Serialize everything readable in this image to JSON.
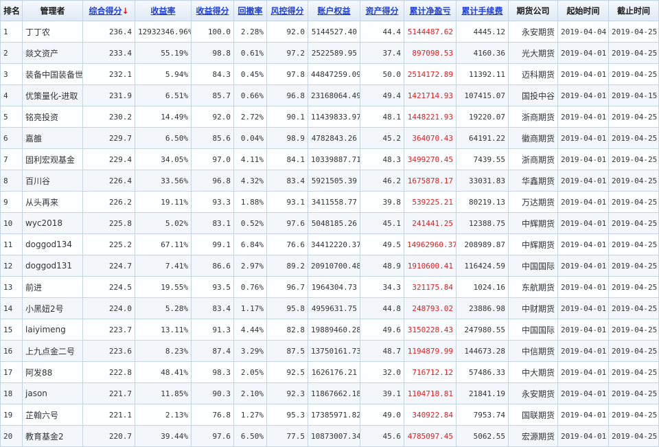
{
  "headers": {
    "rank": "排名",
    "manager": "管理者",
    "total_score": "综合得分",
    "sort_arrow": "↓",
    "return_rate": "收益率",
    "return_score": "收益得分",
    "drawdown": "回撤率",
    "risk_score": "风控得分",
    "equity": "账户权益",
    "asset_score": "资产得分",
    "net_pnl": "累计净盈亏",
    "fees": "累计手续费",
    "company": "期货公司",
    "start": "起始时间",
    "end": "截止时间"
  },
  "colors": {
    "link": "#1f3fd8",
    "negative_highlight": "#e02020",
    "sort_arrow": "#e01010"
  },
  "rows": [
    {
      "rank": "1",
      "manager": "丁丁农",
      "total_score": "236.4",
      "return_rate": "12932346.96%",
      "return_score": "100.0",
      "drawdown": "2.28%",
      "risk_score": "92.0",
      "equity": "5144527.40",
      "asset_score": "44.4",
      "net_pnl": "5144487.62",
      "fees": "4445.12",
      "company": "永安期货",
      "start": "2019-04-04",
      "end": "2019-04-25"
    },
    {
      "rank": "2",
      "manager": "燚文资产",
      "total_score": "233.4",
      "return_rate": "55.19%",
      "return_score": "98.8",
      "drawdown": "0.61%",
      "risk_score": "97.2",
      "equity": "2522589.95",
      "asset_score": "37.4",
      "net_pnl": "897098.53",
      "fees": "4160.36",
      "company": "光大期货",
      "start": "2019-04-01",
      "end": "2019-04-25"
    },
    {
      "rank": "3",
      "manager": "装备中国装备世",
      "total_score": "232.1",
      "return_rate": "5.94%",
      "return_score": "84.3",
      "drawdown": "0.45%",
      "risk_score": "97.8",
      "equity": "44847259.09",
      "asset_score": "50.0",
      "net_pnl": "2514172.89",
      "fees": "11392.11",
      "company": "迈科期货",
      "start": "2019-04-01",
      "end": "2019-04-25"
    },
    {
      "rank": "4",
      "manager": "优策量化-进取",
      "total_score": "231.9",
      "return_rate": "6.51%",
      "return_score": "85.7",
      "drawdown": "0.66%",
      "risk_score": "96.8",
      "equity": "23168064.49",
      "asset_score": "49.4",
      "net_pnl": "1421714.93",
      "fees": "107415.07",
      "company": "国投中谷",
      "start": "2019-04-01",
      "end": "2019-04-15"
    },
    {
      "rank": "5",
      "manager": "铭亮投资",
      "total_score": "230.2",
      "return_rate": "14.49%",
      "return_score": "92.0",
      "drawdown": "2.72%",
      "risk_score": "90.1",
      "equity": "11439833.97",
      "asset_score": "48.1",
      "net_pnl": "1448221.93",
      "fees": "19220.07",
      "company": "浙商期货",
      "start": "2019-04-01",
      "end": "2019-04-25"
    },
    {
      "rank": "6",
      "manager": "嘉雒",
      "total_score": "229.7",
      "return_rate": "6.50%",
      "return_score": "85.6",
      "drawdown": "0.04%",
      "risk_score": "98.9",
      "equity": "4782843.26",
      "asset_score": "45.2",
      "net_pnl": "364070.43",
      "fees": "64191.22",
      "company": "徽商期货",
      "start": "2019-04-01",
      "end": "2019-04-25"
    },
    {
      "rank": "7",
      "manager": "固利宏观基金",
      "total_score": "229.4",
      "return_rate": "34.05%",
      "return_score": "97.0",
      "drawdown": "4.11%",
      "risk_score": "84.1",
      "equity": "10339887.71",
      "asset_score": "48.3",
      "net_pnl": "3499270.45",
      "fees": "7439.55",
      "company": "浙商期货",
      "start": "2019-04-01",
      "end": "2019-04-25"
    },
    {
      "rank": "8",
      "manager": "百川谷",
      "total_score": "226.4",
      "return_rate": "33.56%",
      "return_score": "96.8",
      "drawdown": "4.32%",
      "risk_score": "83.4",
      "equity": "5921505.39",
      "asset_score": "46.2",
      "net_pnl": "1675878.17",
      "fees": "33031.83",
      "company": "华鑫期货",
      "start": "2019-04-01",
      "end": "2019-04-25"
    },
    {
      "rank": "9",
      "manager": "从头再来",
      "total_score": "226.2",
      "return_rate": "19.11%",
      "return_score": "93.3",
      "drawdown": "1.88%",
      "risk_score": "93.1",
      "equity": "3411558.77",
      "asset_score": "39.8",
      "net_pnl": "539225.21",
      "fees": "80219.13",
      "company": "万达期货",
      "start": "2019-04-01",
      "end": "2019-04-25"
    },
    {
      "rank": "10",
      "manager": "wyc2018",
      "total_score": "225.8",
      "return_rate": "5.02%",
      "return_score": "83.1",
      "drawdown": "0.52%",
      "risk_score": "97.6",
      "equity": "5048185.26",
      "asset_score": "45.1",
      "net_pnl": "241441.25",
      "fees": "12388.75",
      "company": "中辉期货",
      "start": "2019-04-01",
      "end": "2019-04-25"
    },
    {
      "rank": "11",
      "manager": "doggod134",
      "total_score": "225.2",
      "return_rate": "67.11%",
      "return_score": "99.1",
      "drawdown": "6.84%",
      "risk_score": "76.6",
      "equity": "34412220.37",
      "asset_score": "49.5",
      "net_pnl": "14962960.37",
      "fees": "208989.87",
      "company": "中辉期货",
      "start": "2019-04-01",
      "end": "2019-04-25"
    },
    {
      "rank": "12",
      "manager": "doggod131",
      "total_score": "224.7",
      "return_rate": "7.41%",
      "return_score": "86.6",
      "drawdown": "2.97%",
      "risk_score": "89.2",
      "equity": "20910700.48",
      "asset_score": "48.9",
      "net_pnl": "1910600.41",
      "fees": "116424.59",
      "company": "中国国际",
      "start": "2019-04-01",
      "end": "2019-04-25"
    },
    {
      "rank": "13",
      "manager": "前进",
      "total_score": "224.5",
      "return_rate": "19.55%",
      "return_score": "93.5",
      "drawdown": "0.76%",
      "risk_score": "96.7",
      "equity": "1964304.73",
      "asset_score": "34.3",
      "net_pnl": "321175.84",
      "fees": "1024.16",
      "company": "东航期货",
      "start": "2019-04-01",
      "end": "2019-04-25"
    },
    {
      "rank": "14",
      "manager": "小黑妞2号",
      "total_score": "224.0",
      "return_rate": "5.28%",
      "return_score": "83.4",
      "drawdown": "1.17%",
      "risk_score": "95.8",
      "equity": "4959631.75",
      "asset_score": "44.8",
      "net_pnl": "248793.02",
      "fees": "23886.98",
      "company": "中财期货",
      "start": "2019-04-01",
      "end": "2019-04-25"
    },
    {
      "rank": "15",
      "manager": "laiyimeng",
      "total_score": "223.7",
      "return_rate": "13.11%",
      "return_score": "91.3",
      "drawdown": "4.44%",
      "risk_score": "82.8",
      "equity": "19889460.28",
      "asset_score": "49.6",
      "net_pnl": "3150228.43",
      "fees": "247980.55",
      "company": "中国国际",
      "start": "2019-04-01",
      "end": "2019-04-25"
    },
    {
      "rank": "16",
      "manager": "上九点金二号",
      "total_score": "223.6",
      "return_rate": "8.23%",
      "return_score": "87.4",
      "drawdown": "3.29%",
      "risk_score": "87.5",
      "equity": "13750161.73",
      "asset_score": "48.7",
      "net_pnl": "1194879.99",
      "fees": "144673.28",
      "company": "中信期货",
      "start": "2019-04-01",
      "end": "2019-04-25"
    },
    {
      "rank": "17",
      "manager": "阿发88",
      "total_score": "222.8",
      "return_rate": "48.41%",
      "return_score": "98.3",
      "drawdown": "2.05%",
      "risk_score": "92.5",
      "equity": "1626176.21",
      "asset_score": "32.0",
      "net_pnl": "716712.12",
      "fees": "57486.33",
      "company": "中大期货",
      "start": "2019-04-01",
      "end": "2019-04-25"
    },
    {
      "rank": "18",
      "manager": "jason",
      "total_score": "221.7",
      "return_rate": "11.85%",
      "return_score": "90.3",
      "drawdown": "2.10%",
      "risk_score": "92.3",
      "equity": "11867662.18",
      "asset_score": "39.1",
      "net_pnl": "1104718.81",
      "fees": "21841.19",
      "company": "永安期货",
      "start": "2019-04-01",
      "end": "2019-04-25"
    },
    {
      "rank": "19",
      "manager": "芷翰六号",
      "total_score": "221.1",
      "return_rate": "2.13%",
      "return_score": "76.8",
      "drawdown": "1.27%",
      "risk_score": "95.3",
      "equity": "17385971.82",
      "asset_score": "49.0",
      "net_pnl": "340922.84",
      "fees": "7953.74",
      "company": "国联期货",
      "start": "2019-04-01",
      "end": "2019-04-25"
    },
    {
      "rank": "20",
      "manager": "教育基金2",
      "total_score": "220.7",
      "return_rate": "39.44%",
      "return_score": "97.6",
      "drawdown": "6.50%",
      "risk_score": "77.5",
      "equity": "10873007.34",
      "asset_score": "45.6",
      "net_pnl": "4785097.45",
      "fees": "5062.55",
      "company": "宏源期货",
      "start": "2019-04-01",
      "end": "2019-04-25"
    }
  ]
}
